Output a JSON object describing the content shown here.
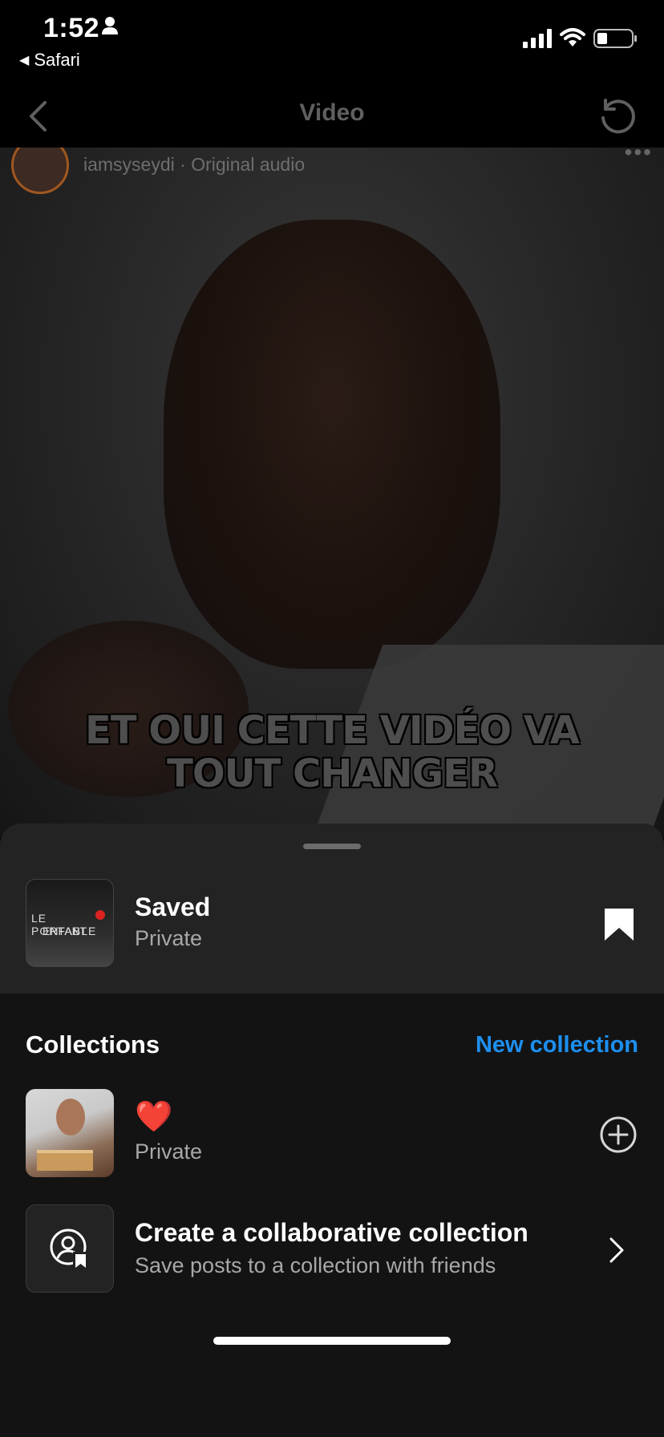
{
  "status_bar": {
    "time": "1:52",
    "back_app": "Safari",
    "icons": [
      "person-icon",
      "signal-icon",
      "wifi-icon",
      "battery-icon"
    ]
  },
  "nav": {
    "title": "Video",
    "back_icon": "chevron-left-icon",
    "refresh_icon": "refresh-icon"
  },
  "video": {
    "subtitle": "iamsyseydi · Original audio",
    "caption_line1": "ET OUI CETTE VIDÉO VA",
    "caption_line2": "TOUT CHANGER"
  },
  "sheet": {
    "saved": {
      "title": "Saved",
      "privacy": "Private",
      "thumb_text1": "LE PORTABLE",
      "thumb_text2": "ENFANT",
      "icon": "bookmark-filled-icon"
    },
    "collections_header": "Collections",
    "new_collection_label": "New collection",
    "items": [
      {
        "title": "❤️",
        "privacy": "Private",
        "action_icon": "add-circle-icon"
      },
      {
        "title": "Create a collaborative collection",
        "subtitle": "Save posts to a collection with friends",
        "icon": "collaborative-collection-icon",
        "action_icon": "chevron-right-icon"
      }
    ]
  },
  "colors": {
    "accent": "#1d8ff0",
    "sheet_bg": "#131313",
    "sheet_top_bg": "#232323"
  }
}
